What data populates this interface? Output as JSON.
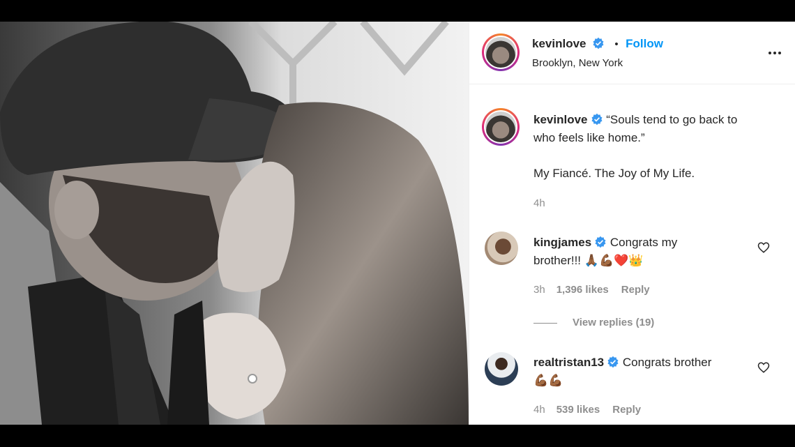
{
  "post": {
    "username": "kevinlove",
    "follow_label": "Follow",
    "dot": "•",
    "location": "Brooklyn, New York",
    "more_label": "•••"
  },
  "caption": {
    "username": "kevinlove",
    "line1": "“Souls tend to go back to",
    "line2": "who feels like home.”",
    "line3": "My Fiancé. The Joy of My Life.",
    "time": "4h"
  },
  "comments": [
    {
      "username": "kingjames",
      "text_line1": "Congrats my",
      "text_line2": "brother!!!",
      "emojis": "🙏🏾💪🏾❤️👑",
      "time": "3h",
      "likes": "1,396 likes",
      "reply": "Reply",
      "view_replies": "View replies (19)"
    },
    {
      "username": "realtristan13",
      "text_line1": "Congrats brother",
      "emojis": "💪🏾💪🏾",
      "time": "4h",
      "likes": "539 likes",
      "reply": "Reply"
    }
  ],
  "colors": {
    "accent": "#0095f6",
    "verified": "#3897f0",
    "muted": "#8e8e8e"
  }
}
